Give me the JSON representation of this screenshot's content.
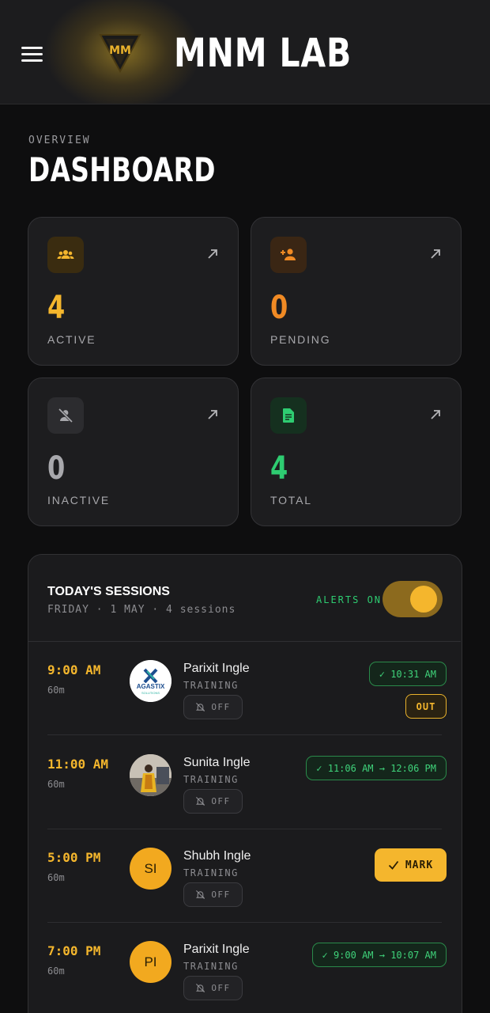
{
  "header": {
    "brand": "MNM LAB",
    "menu_icon": "hamburger-menu-icon",
    "logo_icon": "mnm-shield-logo-icon"
  },
  "overview": {
    "eyebrow": "OVERVIEW",
    "title": "DASHBOARD"
  },
  "stats": [
    {
      "value": "4",
      "label": "ACTIVE",
      "icon": "group-icon",
      "color": "#f4b62d"
    },
    {
      "value": "0",
      "label": "PENDING",
      "icon": "person-add-icon",
      "color": "#f08a24"
    },
    {
      "value": "0",
      "label": "INACTIVE",
      "icon": "person-off-icon",
      "color": "#a8a8ac"
    },
    {
      "value": "4",
      "label": "TOTAL",
      "icon": "document-icon",
      "color": "#2ecc71"
    }
  ],
  "sessions": {
    "title": "TODAY'S SESSIONS",
    "subtitle": "FRIDAY · 1 MAY · 4 sessions",
    "alerts_label": "ALERTS ON",
    "alerts_on": true,
    "rows": [
      {
        "time": "9:00 AM",
        "duration": "60m",
        "name": "Parixit Ingle",
        "role": "TRAINING",
        "notify": "OFF",
        "avatar": "agastix-logo",
        "status": "✓ 10:31 AM",
        "action": "OUT"
      },
      {
        "time": "11:00 AM",
        "duration": "60m",
        "name": "Sunita Ingle",
        "role": "TRAINING",
        "notify": "OFF",
        "avatar": "photo",
        "status": "✓ 11:06 AM → 12:06 PM"
      },
      {
        "time": "5:00 PM",
        "duration": "60m",
        "name": "Shubh Ingle",
        "role": "TRAINING",
        "notify": "OFF",
        "avatar": "SI",
        "action": "MARK"
      },
      {
        "time": "7:00 PM",
        "duration": "60m",
        "name": "Parixit Ingle",
        "role": "TRAINING",
        "notify": "OFF",
        "avatar": "PI",
        "status": "✓ 9:00 AM → 10:07 AM"
      }
    ]
  },
  "colors": {
    "accent": "#f4b62d",
    "success": "#2ecc71",
    "background": "#0e0e0f",
    "card": "#1d1d1f"
  }
}
